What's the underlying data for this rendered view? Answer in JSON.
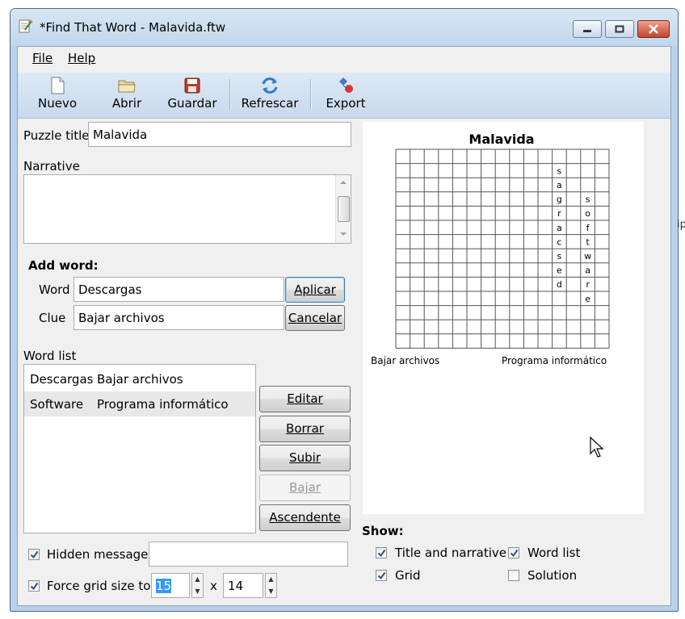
{
  "window": {
    "title": "*Find That Word - Malavida.ftw"
  },
  "menu": {
    "file": "File",
    "help": "Help"
  },
  "toolbar": {
    "new": "Nuevo",
    "open": "Abrir",
    "save": "Guardar",
    "refresh": "Refrescar",
    "export": "Export"
  },
  "form": {
    "puzzle_title_label": "Puzzle title",
    "puzzle_title_value": "Malavida",
    "narrative_label": "Narrative",
    "narrative_value": "",
    "add_word_heading": "Add word:",
    "word_label": "Word",
    "word_value": "Descargas",
    "clue_label": "Clue",
    "clue_value": "Bajar archivos",
    "apply_button": "Aplicar",
    "cancel_button": "Cancelar"
  },
  "word_list": {
    "label": "Word list",
    "rows": [
      {
        "word": "Descargas",
        "clue": "Bajar archivos"
      },
      {
        "word": "Software",
        "clue": "Programa informático"
      }
    ],
    "buttons": {
      "edit": "Editar",
      "delete": "Borrar",
      "up": "Subir",
      "down": "Bajar",
      "sort": "Ascendente"
    }
  },
  "options": {
    "hidden_message_label": "Hidden message",
    "hidden_message_checked": true,
    "hidden_message_value": "",
    "force_grid_label": "Force grid size to",
    "force_grid_checked": true,
    "grid_cols": "15",
    "times": "x",
    "grid_rows": "14"
  },
  "show": {
    "heading": "Show:",
    "title_narrative": "Title and narrative",
    "title_narrative_checked": true,
    "word_list": "Word list",
    "word_list_checked": true,
    "grid": "Grid",
    "grid_checked": true,
    "solution": "Solution",
    "solution_checked": false
  },
  "preview": {
    "title": "Malavida",
    "grid_cols": 15,
    "grid_rows": 14,
    "letters": [
      {
        "col": 11,
        "row": 1,
        "ch": "s"
      },
      {
        "col": 11,
        "row": 2,
        "ch": "a"
      },
      {
        "col": 11,
        "row": 3,
        "ch": "g"
      },
      {
        "col": 11,
        "row": 4,
        "ch": "r"
      },
      {
        "col": 11,
        "row": 5,
        "ch": "a"
      },
      {
        "col": 11,
        "row": 6,
        "ch": "c"
      },
      {
        "col": 11,
        "row": 7,
        "ch": "s"
      },
      {
        "col": 11,
        "row": 8,
        "ch": "e"
      },
      {
        "col": 11,
        "row": 9,
        "ch": "d"
      },
      {
        "col": 13,
        "row": 3,
        "ch": "s"
      },
      {
        "col": 13,
        "row": 4,
        "ch": "o"
      },
      {
        "col": 13,
        "row": 5,
        "ch": "f"
      },
      {
        "col": 13,
        "row": 6,
        "ch": "t"
      },
      {
        "col": 13,
        "row": 7,
        "ch": "w"
      },
      {
        "col": 13,
        "row": 8,
        "ch": "a"
      },
      {
        "col": 13,
        "row": 9,
        "ch": "r"
      },
      {
        "col": 13,
        "row": 10,
        "ch": "e"
      }
    ],
    "clue_left": "Bajar archivos",
    "clue_right": "Programa informático"
  },
  "colors": {
    "chrome": "#b9d1ea",
    "selection": "#3399ff",
    "checkmark": "#2a4f8f"
  },
  "stray_text": "ip"
}
